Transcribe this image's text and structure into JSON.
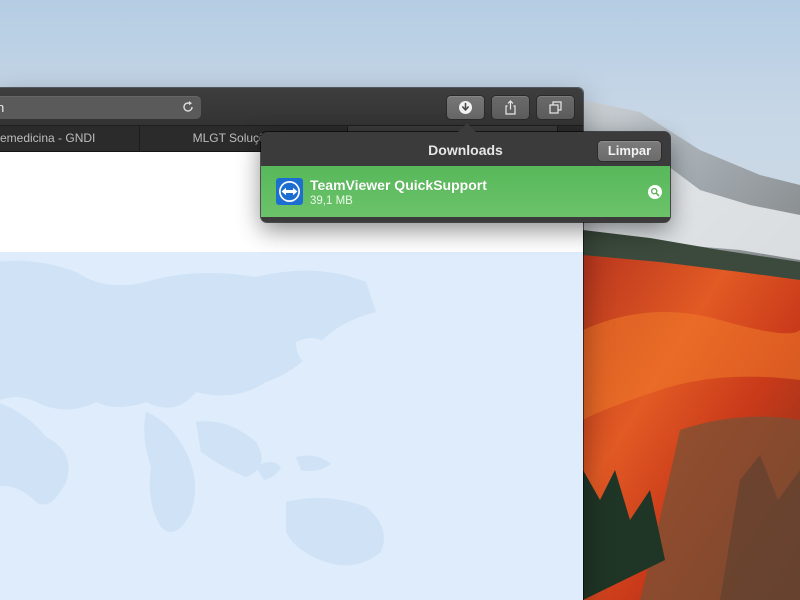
{
  "browser": {
    "address_fragment": "n",
    "tabs": [
      {
        "label": "emedicina - GNDI"
      },
      {
        "label": "MLGT Soluções em"
      },
      {
        "label": ""
      }
    ],
    "toolbar_icons": [
      "download-arrow-icon",
      "share-icon",
      "tabs-overview-icon",
      "reload-icon"
    ]
  },
  "downloads": {
    "title": "Downloads",
    "clear_label": "Limpar",
    "items": [
      {
        "name": "TeamViewer QuickSupport",
        "size": "39,1 MB",
        "icon": "teamviewer-app-icon"
      }
    ]
  },
  "colors": {
    "download_row": "#5fbd5e",
    "toolbar": "#3a3a3b",
    "popover": "#3b3b3c"
  }
}
